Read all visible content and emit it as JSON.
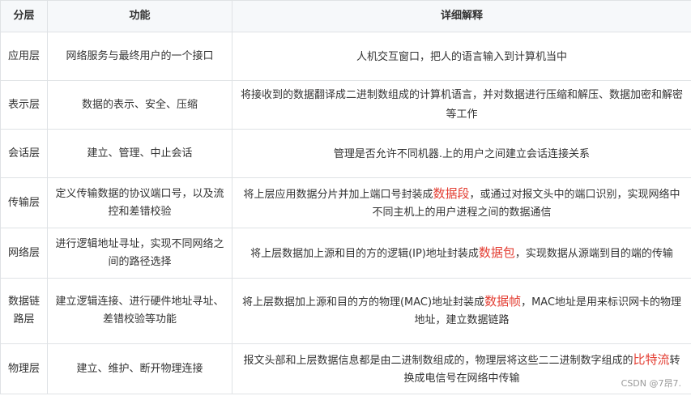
{
  "table": {
    "headers": [
      "分层",
      "功能",
      "详细解释"
    ],
    "rows": [
      {
        "layer": "应用层",
        "function": "网络服务与最终用户的一个接口",
        "detail_before": "人机交互窗口，把人的语言输入到计算机当中",
        "detail_highlight": "",
        "detail_after": ""
      },
      {
        "layer": "表示层",
        "function": "数据的表示、安全、压缩",
        "detail_before": "将接收到的数据翻译成二进制数组成的计算机语言，并对数据进行压缩和解压、数据加密和解密等工作",
        "detail_highlight": "",
        "detail_after": ""
      },
      {
        "layer": "会话层",
        "function": "建立、管理、中止会话",
        "detail_before": "管理是否允许不同机器.上的用户之间建立会话连接关系",
        "detail_highlight": "",
        "detail_after": ""
      },
      {
        "layer": "传输层",
        "function": "定义传输数据的协议端口号，以及流控和差错校验",
        "detail_before": "将上层应用数据分片并加上端口号封装成",
        "detail_highlight": "数据段",
        "detail_after": "，或通过对报文头中的端口识别，实现网络中不同主机上的用户进程之间的数据通信"
      },
      {
        "layer": "网络层",
        "function": "进行逻辑地址寻址，实现不同网络之间的路径选择",
        "detail_before": "将上层数据加上源和目的方的逻辑(IP)地址封装成",
        "detail_highlight": "数据包",
        "detail_after": "，实现数据从源端到目的端的传输"
      },
      {
        "layer": "数据链路层",
        "function": "建立逻辑连接、进行硬件地址寻址、差错校验等功能",
        "detail_before": "将上层数据加上源和目的方的物理(MAC)地址封装成",
        "detail_highlight": "数据帧",
        "detail_after": "，MAC地址是用来标识网卡的物理地址，建立数据链路"
      },
      {
        "layer": "物理层",
        "function": "建立、维护、断开物理连接",
        "detail_before": "报文头部和上层数据信息都是由二进制数组成的，物理层将这些二二进制数字组成的",
        "detail_highlight": "比特流",
        "detail_after": "转换成电信号在网络中传输"
      }
    ]
  },
  "watermark": "CSDN @7昂7.",
  "colors": {
    "highlight": "#e33e33",
    "header_bg": "#f6f8fa",
    "border": "#dfe2e5"
  }
}
